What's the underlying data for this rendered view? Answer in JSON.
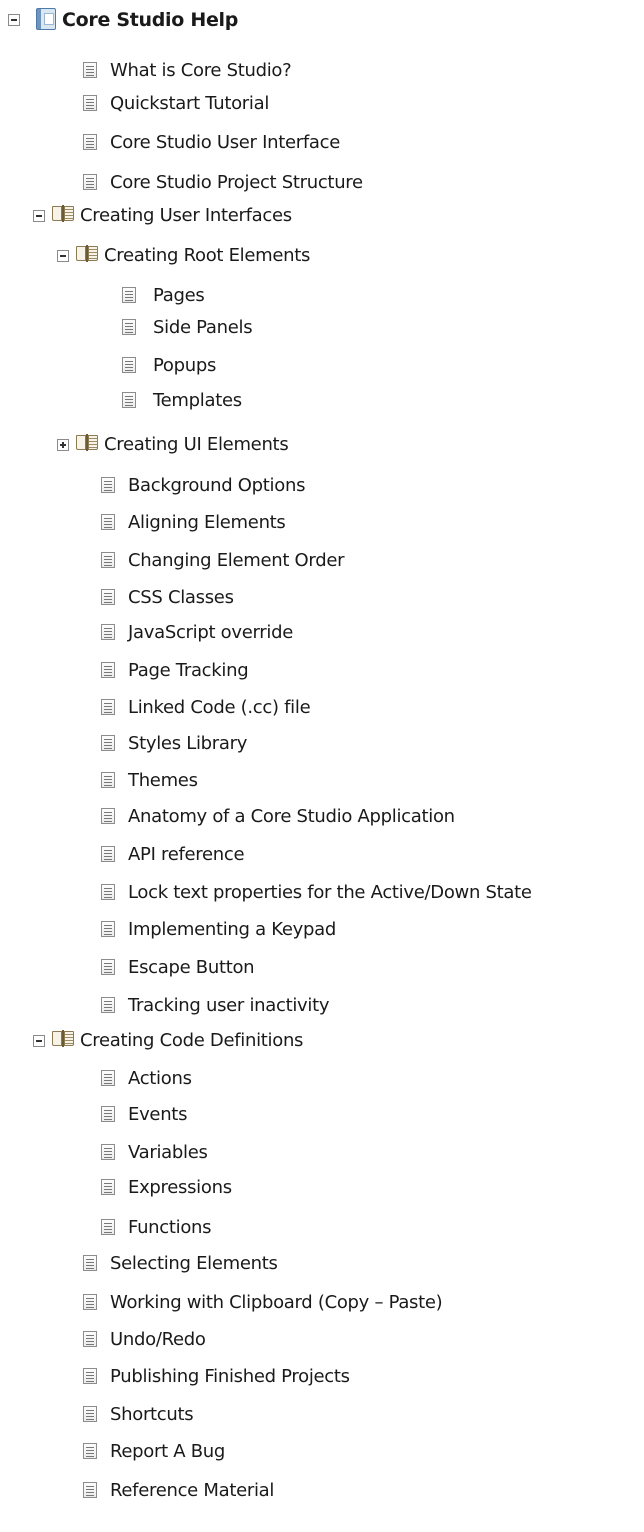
{
  "tree": [
    {
      "label": "Core Studio Help",
      "icon": "help-root-icon",
      "toggle": "collapse",
      "level": 0
    },
    {
      "label": "What is Core Studio?",
      "icon": "page-icon",
      "level": 1
    },
    {
      "label": "Quickstart Tutorial",
      "icon": "page-icon",
      "level": 1
    },
    {
      "label": "Core Studio User Interface",
      "icon": "page-icon",
      "level": 1
    },
    {
      "label": "Core Studio Project Structure",
      "icon": "page-icon",
      "level": 1
    },
    {
      "label": "Creating User Interfaces",
      "icon": "book-icon",
      "toggle": "collapse",
      "level": 1
    },
    {
      "label": "Creating Root Elements",
      "icon": "book-icon",
      "toggle": "collapse",
      "level": 2
    },
    {
      "label": "Pages",
      "icon": "page-icon",
      "level": 3
    },
    {
      "label": "Side Panels",
      "icon": "page-icon",
      "level": 3
    },
    {
      "label": "Popups",
      "icon": "page-icon",
      "level": 3
    },
    {
      "label": "Templates",
      "icon": "page-icon",
      "level": 3
    },
    {
      "label": "Creating UI Elements",
      "icon": "book-icon",
      "toggle": "expand",
      "level": 2
    },
    {
      "label": "Background Options",
      "icon": "page-icon",
      "level": 2
    },
    {
      "label": "Aligning Elements",
      "icon": "page-icon",
      "level": 2
    },
    {
      "label": "Changing Element Order",
      "icon": "page-icon",
      "level": 2
    },
    {
      "label": "CSS Classes",
      "icon": "page-icon",
      "level": 2
    },
    {
      "label": "JavaScript override",
      "icon": "page-icon",
      "level": 2
    },
    {
      "label": "Page Tracking",
      "icon": "page-icon",
      "level": 2
    },
    {
      "label": "Linked Code (.cc) file",
      "icon": "page-icon",
      "level": 2
    },
    {
      "label": "Styles Library",
      "icon": "page-icon",
      "level": 2
    },
    {
      "label": "Themes",
      "icon": "page-icon",
      "level": 2
    },
    {
      "label": "Anatomy of a Core Studio Application",
      "icon": "page-icon",
      "level": 2
    },
    {
      "label": "API reference",
      "icon": "page-icon",
      "level": 2
    },
    {
      "label": "Lock text properties for the Active/Down State",
      "icon": "page-icon",
      "level": 2
    },
    {
      "label": "Implementing a Keypad",
      "icon": "page-icon",
      "level": 2
    },
    {
      "label": "Escape Button",
      "icon": "page-icon",
      "level": 2
    },
    {
      "label": "Tracking user inactivity",
      "icon": "page-icon",
      "level": 2
    },
    {
      "label": "Creating Code Definitions",
      "icon": "book-icon",
      "toggle": "collapse",
      "level": 1
    },
    {
      "label": "Actions",
      "icon": "page-icon",
      "level": 2
    },
    {
      "label": "Events",
      "icon": "page-icon",
      "level": 2
    },
    {
      "label": "Variables",
      "icon": "page-icon",
      "level": 2
    },
    {
      "label": "Expressions",
      "icon": "page-icon",
      "level": 2
    },
    {
      "label": "Functions",
      "icon": "page-icon",
      "level": 2
    },
    {
      "label": "Selecting Elements",
      "icon": "page-icon",
      "level": 1
    },
    {
      "label": "Working with Clipboard (Copy – Paste)",
      "icon": "page-icon",
      "level": 1
    },
    {
      "label": "Undo/Redo",
      "icon": "page-icon",
      "level": 1
    },
    {
      "label": "Publishing Finished Projects",
      "icon": "page-icon",
      "level": 1
    },
    {
      "label": "Shortcuts",
      "icon": "page-icon",
      "level": 1
    },
    {
      "label": "Report A Bug",
      "icon": "page-icon",
      "level": 1
    },
    {
      "label": "Reference Material",
      "icon": "page-icon",
      "level": 1
    }
  ]
}
